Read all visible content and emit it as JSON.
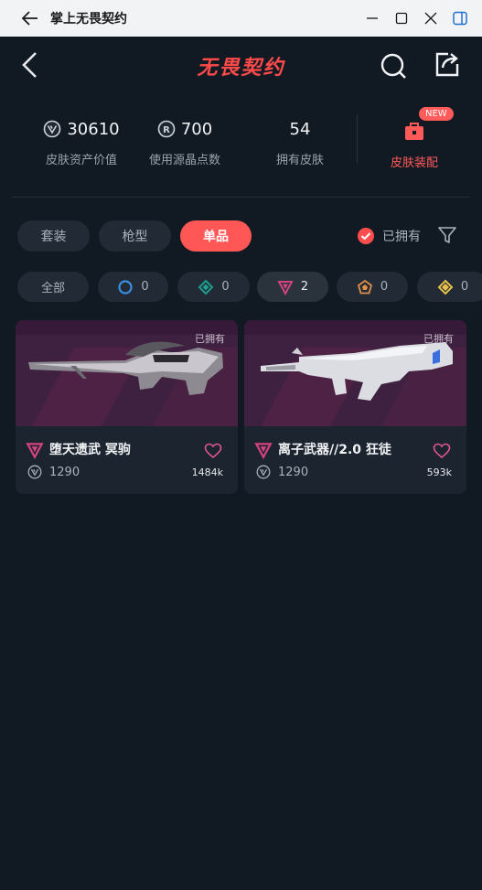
{
  "window": {
    "title": "掌上无畏契约",
    "icons": [
      "back-arrow-icon",
      "minimize-icon",
      "maximize-icon",
      "close-icon",
      "sidebar-icon"
    ]
  },
  "header": {
    "logo_text": "无畏契约",
    "icons": [
      "back-chevron-icon",
      "search-icon",
      "share-icon"
    ]
  },
  "stats": {
    "asset_value": "30610",
    "asset_value_label": "皮肤资产价值",
    "radianite_points": "700",
    "radianite_points_label": "使用源晶点数",
    "owned_skins": "54",
    "owned_skins_label": "拥有皮肤",
    "equip_label": "皮肤装配",
    "equip_badge": "NEW"
  },
  "tabs": [
    {
      "label": "套装",
      "active": false
    },
    {
      "label": "枪型",
      "active": false
    },
    {
      "label": "单品",
      "active": true
    }
  ],
  "owned_filter": {
    "label": "已拥有",
    "checked": true
  },
  "tiers": [
    {
      "label": "全部",
      "count": "",
      "icon": "all"
    },
    {
      "label": "",
      "count": "0",
      "icon": "select-tier-blue-icon",
      "color": "#3a8fe0"
    },
    {
      "label": "",
      "count": "0",
      "icon": "deluxe-tier-green-icon",
      "color": "#1e9e8e"
    },
    {
      "label": "",
      "count": "2",
      "icon": "premium-tier-pink-icon",
      "color": "#d4437d",
      "selected": true
    },
    {
      "label": "",
      "count": "0",
      "icon": "exclusive-tier-orange-icon",
      "color": "#e0904a"
    },
    {
      "label": "",
      "count": "0",
      "icon": "ultra-tier-gold-icon",
      "color": "#e8c04a"
    }
  ],
  "cards": [
    {
      "name": "堕天遗武 冥驹",
      "price": "1290",
      "likes": "1484k",
      "owned_label": "已拥有"
    },
    {
      "name": "离子武器//2.0 狂徒",
      "price": "1290",
      "likes": "593k",
      "owned_label": "已拥有"
    }
  ],
  "colors": {
    "background": "#111923",
    "accent": "#ff5656",
    "chip": "#222b35",
    "card": "#1b242f",
    "card_art": "#3e2040"
  }
}
